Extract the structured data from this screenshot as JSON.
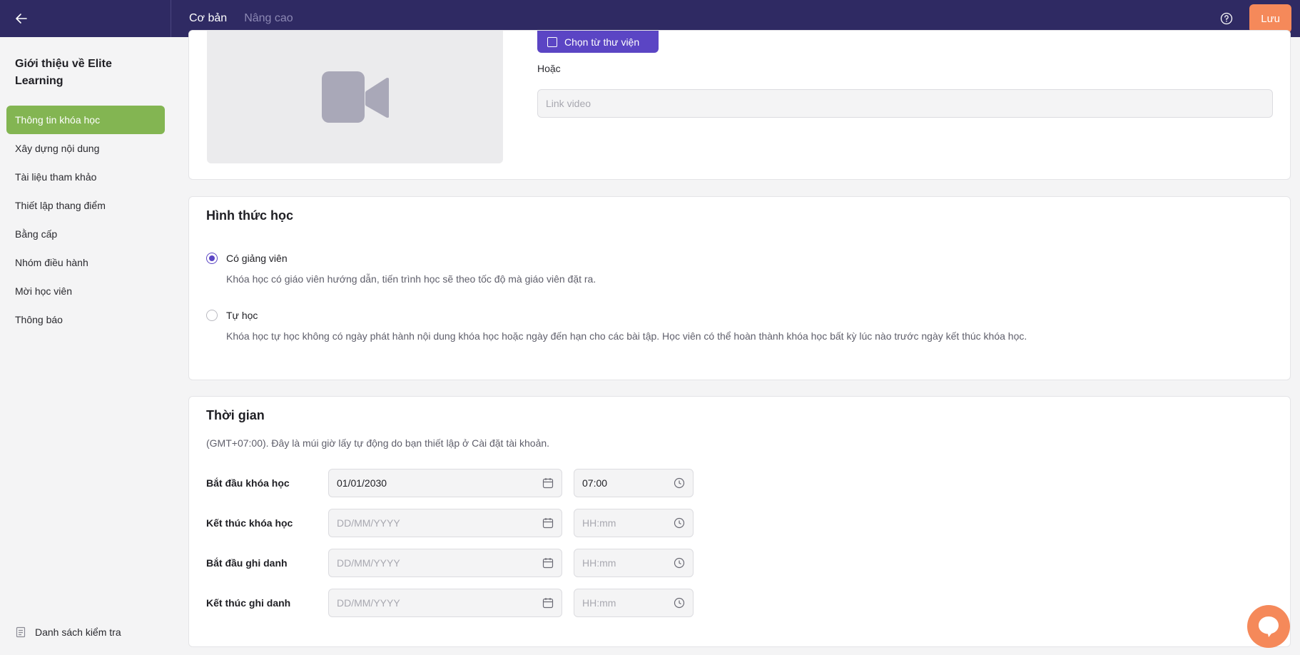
{
  "header": {
    "tabs": [
      {
        "label": "Cơ bản",
        "active": true
      },
      {
        "label": "Nâng cao",
        "active": false
      }
    ],
    "save_label": "Lưu",
    "icons": {
      "back": "arrow-left-icon",
      "help": "help-circle-icon"
    }
  },
  "sidebar": {
    "course_title": "Giới thiệu về Elite Learning",
    "items": [
      {
        "label": "Thông tin khóa học",
        "active": true
      },
      {
        "label": "Xây dựng nội dung"
      },
      {
        "label": "Tài liệu tham khảo"
      },
      {
        "label": "Thiết lập thang điểm"
      },
      {
        "label": "Bằng cấp"
      },
      {
        "label": "Nhóm điều hành"
      },
      {
        "label": "Mời học viên"
      },
      {
        "label": "Thông báo"
      }
    ],
    "checklist_label": "Danh sách kiểm tra"
  },
  "video": {
    "library_button": "Chọn từ thư viện",
    "or_label": "Hoặc",
    "link_placeholder": "Link video"
  },
  "mode": {
    "title": "Hình thức học",
    "options": [
      {
        "label": "Có giảng viên",
        "description": "Khóa học có giáo viên hướng dẫn, tiến trình học sẽ theo tốc độ mà giáo viên đặt ra.",
        "checked": true
      },
      {
        "label": "Tự học",
        "description": "Khóa học tự học không có ngày phát hành nội dung khóa học hoặc ngày đến hạn cho các bài tập. Học viên có thể hoàn thành khóa học bất kỳ lúc nào trước ngày kết thúc khóa học.",
        "checked": false
      }
    ]
  },
  "time": {
    "title": "Thời gian",
    "timezone_note": "(GMT+07:00). Đây là múi giờ lấy tự động do bạn thiết lập ở Cài đặt tài khoản.",
    "rows": [
      {
        "label": "Bắt đầu khóa học",
        "date": "01/01/2030",
        "time": "07:00"
      },
      {
        "label": "Kết thúc khóa học",
        "date_placeholder": "DD/MM/YYYY",
        "time_placeholder": "HH:mm"
      },
      {
        "label": "Bắt đầu ghi danh",
        "date_placeholder": "DD/MM/YYYY",
        "time_placeholder": "HH:mm"
      },
      {
        "label": "Kết thúc ghi danh",
        "date_placeholder": "DD/MM/YYYY",
        "time_placeholder": "HH:mm"
      }
    ]
  },
  "colors": {
    "header_bg": "#2f2a63",
    "accent_purple": "#5b45c4",
    "active_green": "#83b552",
    "save_orange": "#f5895a"
  }
}
